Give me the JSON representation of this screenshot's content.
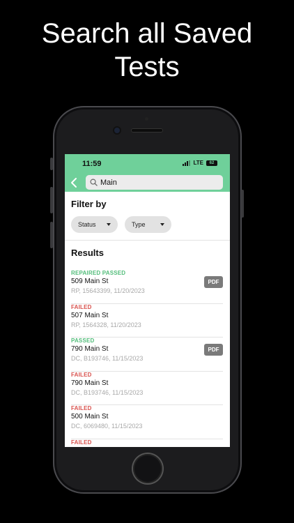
{
  "headline": {
    "line1": "Search all Saved",
    "line2": "Tests"
  },
  "status_bar": {
    "time": "11:59",
    "network": "LTE",
    "battery": "62"
  },
  "search": {
    "value": "Main"
  },
  "filter": {
    "title": "Filter by",
    "chips": [
      {
        "label": "Status"
      },
      {
        "label": "Type"
      }
    ]
  },
  "results": {
    "title": "Results",
    "items": [
      {
        "status": "REPAIRED PASSED",
        "address": "509 Main St",
        "meta": "RP, 15643399, 11/20/2023",
        "pdf": "PDF"
      },
      {
        "status": "FAILED",
        "address": "507 Main St",
        "meta": "RP, 1564328, 11/20/2023",
        "pdf": ""
      },
      {
        "status": "PASSED",
        "address": "790 Main St",
        "meta": "DC, B193746, 11/15/2023",
        "pdf": "PDF"
      },
      {
        "status": "FAILED",
        "address": "790 Main St",
        "meta": "DC, B193746, 11/15/2023",
        "pdf": ""
      },
      {
        "status": "FAILED",
        "address": "500 Main St",
        "meta": "DC, 6069480, 11/15/2023",
        "pdf": ""
      },
      {
        "status": "FAILED",
        "address": "",
        "meta": "",
        "pdf": ""
      }
    ]
  },
  "colors": {
    "header_green": "#6fd09a",
    "passed_green": "#52bd7a",
    "failed_red": "#d9534f",
    "pdf_gray": "#7a7a7a"
  },
  "icons": {
    "back": "chevron-left-icon",
    "search": "magnifier-icon",
    "dropdown": "caret-down-icon"
  }
}
